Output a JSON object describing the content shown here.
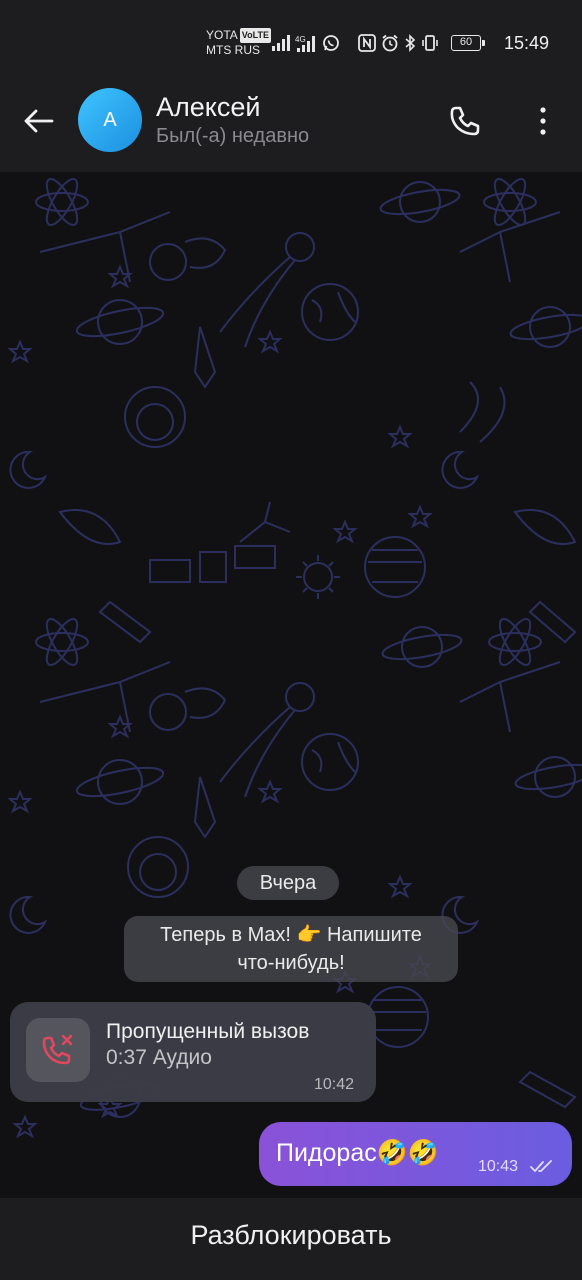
{
  "status_bar": {
    "carrier_top": "YOTA",
    "volte": "VoLTE",
    "carrier_bottom": "MTS RUS",
    "battery": "60",
    "time": "15:49",
    "icons": [
      "signal-icon",
      "4g-signal-icon",
      "whatsapp-icon",
      "nfc-icon",
      "alarm-icon",
      "bluetooth-icon",
      "vibrate-icon",
      "battery-icon"
    ]
  },
  "header": {
    "avatar_letter": "A",
    "contact_name": "Алексей",
    "presence": "Был(-а) недавно",
    "icons": [
      "back-arrow-icon",
      "phone-call-icon",
      "more-vert-icon"
    ]
  },
  "chat": {
    "date_separator": "Вчера",
    "system_message": {
      "line1": "Теперь в Max! 👉 Напишите",
      "line2": "что-нибудь!"
    },
    "missed_call": {
      "title": "Пропущенный вызов",
      "details": "0:37 Аудио",
      "time": "10:42",
      "icon": "missed-call-icon"
    },
    "outgoing_message": {
      "text": "Пидорас🤣🤣",
      "time": "10:43",
      "status_icon": "double-check-icon"
    }
  },
  "bottom_bar": {
    "action_label": "Разблокировать"
  },
  "colors": {
    "bar_background": "#1d1d1f",
    "chat_background": "#111113",
    "pattern_stroke": "#2c2f5e",
    "avatar_gradient": [
      "#3fc4ff",
      "#1c8fe0"
    ],
    "outgoing_gradient": [
      "#8a52d8",
      "#6b5de0"
    ],
    "missed_call_red": "#e0485e"
  }
}
